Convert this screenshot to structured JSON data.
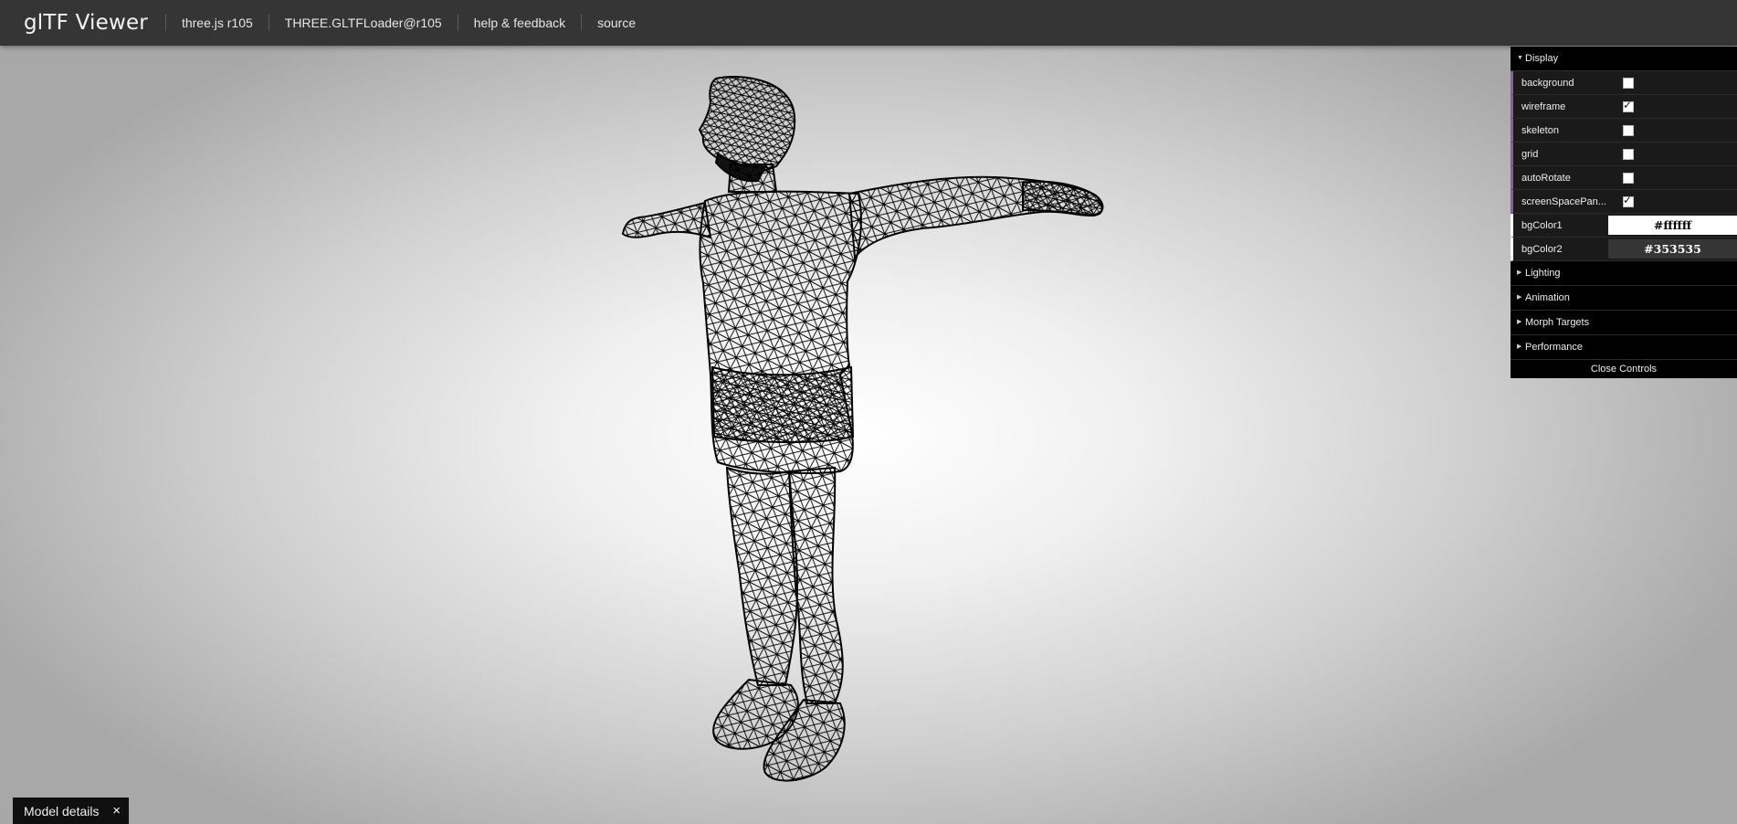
{
  "header": {
    "title": "glTF Viewer",
    "links": [
      "three.js r105",
      "THREE.GLTFLoader@r105",
      "help & feedback",
      "source"
    ]
  },
  "controls": {
    "display_folder": "Display",
    "items": [
      {
        "label": "background",
        "checked": false
      },
      {
        "label": "wireframe",
        "checked": true
      },
      {
        "label": "skeleton",
        "checked": false
      },
      {
        "label": "grid",
        "checked": false
      },
      {
        "label": "autoRotate",
        "checked": false
      },
      {
        "label": "screenSpacePan...",
        "checked": true
      }
    ],
    "colors": [
      {
        "label": "bgColor1",
        "value": "#ffffff"
      },
      {
        "label": "bgColor2",
        "value": "#353535"
      }
    ],
    "folders": [
      "Lighting",
      "Animation",
      "Morph Targets",
      "Performance"
    ],
    "close_label": "Close Controls"
  },
  "model_details": {
    "label": "Model details",
    "close_icon": "×"
  }
}
